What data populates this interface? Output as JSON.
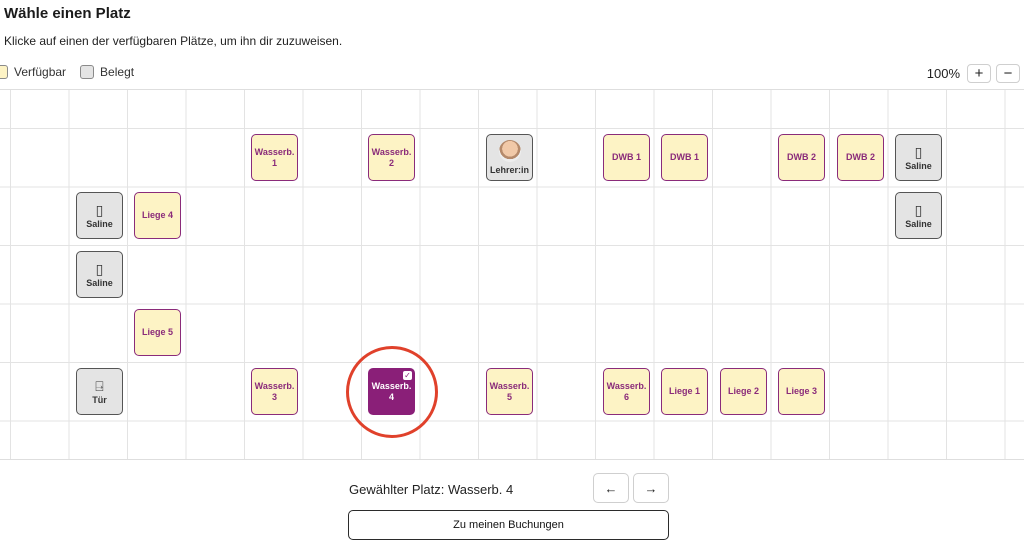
{
  "header": {
    "title": "Wähle einen Platz",
    "subtitle": "Klicke auf einen der verfügbaren Plätze, um ihn dir zuzuweisen."
  },
  "legend": {
    "available_label": "Verfügbar",
    "occupied_label": "Belegt"
  },
  "zoom": {
    "level": "100%",
    "plus": "+",
    "minus": "−"
  },
  "seats": {
    "wasserb1": {
      "line1": "Wasserb.",
      "line2": "1"
    },
    "wasserb2": {
      "line1": "Wasserb.",
      "line2": "2"
    },
    "teacher": "Lehrer:in",
    "dwb1a": "DWB 1",
    "dwb1b": "DWB 1",
    "dwb2a": "DWB 2",
    "dwb2b": "DWB 2",
    "saline_top_right": "Saline",
    "saline_left_1": "Saline",
    "liege4": "Liege 4",
    "saline_right_2": "Saline",
    "saline_left_2": "Saline",
    "liege5": "Liege 5",
    "door": "Tür",
    "wasserb3": {
      "line1": "Wasserb.",
      "line2": "3"
    },
    "wasserb4": {
      "line1": "Wasserb.",
      "line2": "4"
    },
    "wasserb5": {
      "line1": "Wasserb.",
      "line2": "5"
    },
    "wasserb6": {
      "line1": "Wasserb.",
      "line2": "6"
    },
    "liege1": "Liege 1",
    "liege2": "Liege 2",
    "liege3": "Liege 3"
  },
  "footer": {
    "selected_text": "Gewählter Platz: Wasserb. 4",
    "prev_arrow": "←",
    "next_arrow": "→",
    "bookings_button": "Zu meinen Buchungen"
  },
  "colors": {
    "available_bg": "#fdf3c5",
    "accent": "#8a2b7a",
    "selected_bg": "#8a1f78",
    "highlight_ring": "#e0412b",
    "occupied_bg": "#e4e4e4"
  }
}
